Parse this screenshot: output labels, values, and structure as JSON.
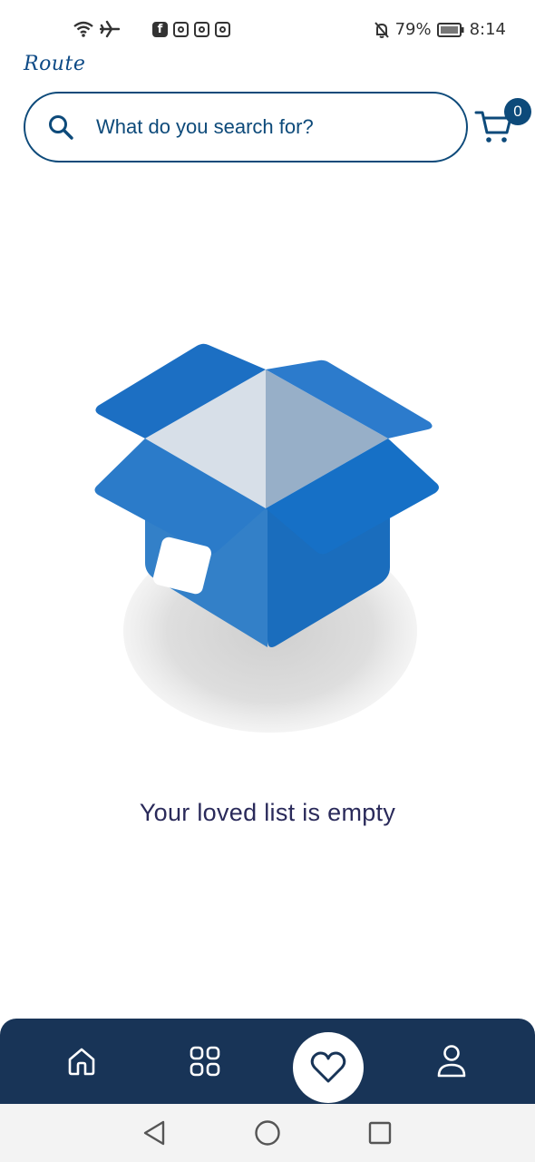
{
  "status_bar": {
    "battery_percent": "79%",
    "time": "8:14",
    "icons": [
      "wifi-icon",
      "airplane-icon",
      "facebook-icon",
      "instagram-icon",
      "instagram-icon",
      "instagram-icon",
      "mute-bell-icon",
      "battery-icon"
    ]
  },
  "app": {
    "brand": "Route"
  },
  "search": {
    "placeholder": "What do you search for?",
    "icon": "search-icon"
  },
  "cart": {
    "icon": "cart-icon",
    "count": "0"
  },
  "empty_state": {
    "illustration": "open-box-icon",
    "message": "Your loved list is empty"
  },
  "bottom_nav": {
    "items": [
      {
        "icon": "home-icon",
        "active": false
      },
      {
        "icon": "categories-icon",
        "active": false
      },
      {
        "icon": "heart-icon",
        "active": true
      },
      {
        "icon": "profile-icon",
        "active": false
      }
    ]
  },
  "system_nav": {
    "buttons": [
      "back-icon",
      "home-circle-icon",
      "recents-icon"
    ]
  },
  "colors": {
    "primary": "#0d4a7a",
    "nav_background": "#183457",
    "box_blue": "#1d6fc0"
  }
}
